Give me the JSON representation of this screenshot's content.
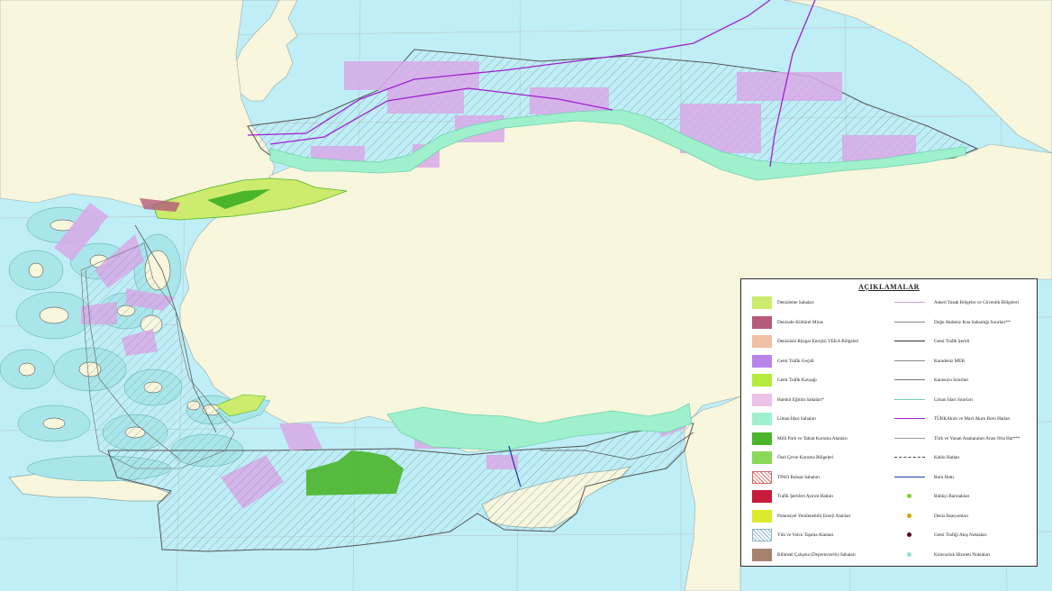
{
  "legend": {
    "title": "AÇIKLAMALAR",
    "left_items": [
      {
        "label": "Denizleme Sahaları",
        "fill": "#cdeb6c",
        "pattern": "solid"
      },
      {
        "label": "Denizaltı Kültürel Miras",
        "fill": "#b55a7a",
        "pattern": "solid"
      },
      {
        "label": "Denizüstü Rüzgar Enerjisi YEKA Bölgeleri",
        "fill": "#efc0a3",
        "pattern": "solid"
      },
      {
        "label": "Gemi Trafik Geçidi",
        "fill": "#b884ea",
        "pattern": "solid"
      },
      {
        "label": "Gemi Trafik Kavşağı",
        "fill": "#b3ea3c",
        "pattern": "solid"
      },
      {
        "label": "Hamkit Eğitim Sahaları*",
        "fill": "#ebc1e8",
        "pattern": "solid"
      },
      {
        "label": "Liman İdari Sahaları",
        "fill": "#9ef1cc",
        "pattern": "solid"
      },
      {
        "label": "Milli Park ve Tabiat Koruma Alanları",
        "fill": "#4ab52a",
        "pattern": "solid"
      },
      {
        "label": "Özel Çevre Koruma Bölgeleri",
        "fill": "#8ad85a",
        "pattern": "solid"
      },
      {
        "label": "TPAO Ruhsat Sahaları",
        "fill": "#ffffff",
        "pattern": "hatch-red"
      },
      {
        "label": "Trafik Şeritleri Ayırım Hatları",
        "fill": "#c81d3a",
        "pattern": "solid"
      },
      {
        "label": "Potansiyel Yenilenebilir Enerji Alanları",
        "fill": "#dcea2c",
        "pattern": "solid"
      },
      {
        "label": "Yük ve Yolcu Taşıma Alanları",
        "fill": "#ffffff",
        "pattern": "hatch-blue"
      },
      {
        "label": "Bilimsel Çalışma (Deprem/sel/k) Sahaları",
        "fill": "#a6826e",
        "pattern": "solid"
      }
    ],
    "right_items": [
      {
        "label": "Askeri Yasak Bölgeler ve Güvenlik Bölgeleri",
        "color": "#c9a0e6",
        "style": "solid"
      },
      {
        "label": "Doğu Akdeniz Kıta Sahanlığı Sınırları**",
        "color": "#888888",
        "style": "solid"
      },
      {
        "label": "Gemi Trafik Şeridi",
        "color": "#333333",
        "style": "solid"
      },
      {
        "label": "Karadeniz MEB",
        "color": "#8a8a8a",
        "style": "solid"
      },
      {
        "label": "Karasuyu Sınırları",
        "color": "#777777",
        "style": "solid"
      },
      {
        "label": "Liman İdari Sınırları",
        "color": "#6fd3b0",
        "style": "solid"
      },
      {
        "label": "TÜRKAkım ve Mavi Akım Boru Hatları",
        "color": "#a020d0",
        "style": "solid"
      },
      {
        "label": "Türk ve Yunan Anakaraları Arası Orta Hat***",
        "color": "#999999",
        "style": "solid"
      },
      {
        "label": "Kablo Hatları",
        "color": "#444444",
        "style": "dashed"
      },
      {
        "label": "Boru Hattı",
        "color": "#1a3fb0",
        "style": "solid"
      },
      {
        "label": "Balıkçı Barınakları",
        "color": "#7fcf2a",
        "style": "dot"
      },
      {
        "label": "Deniz İstasyonları",
        "color": "#d7a300",
        "style": "dot"
      },
      {
        "label": "Gemi Trafiği Akış Noktaları",
        "color": "#5a0016",
        "style": "dot"
      },
      {
        "label": "Kılavuzluk Hizmeti Noktaları",
        "color": "#8ee0d0",
        "style": "dot"
      }
    ]
  },
  "colors": {
    "sea": "#bfeef6",
    "land": "#f8f6dc",
    "coast_buffer": "#9ef1cc",
    "restricted": "#d8a9e8",
    "hatch": "#7a9bb0",
    "pipeline": "#a020d0",
    "protected_green": "#4ab52a"
  }
}
